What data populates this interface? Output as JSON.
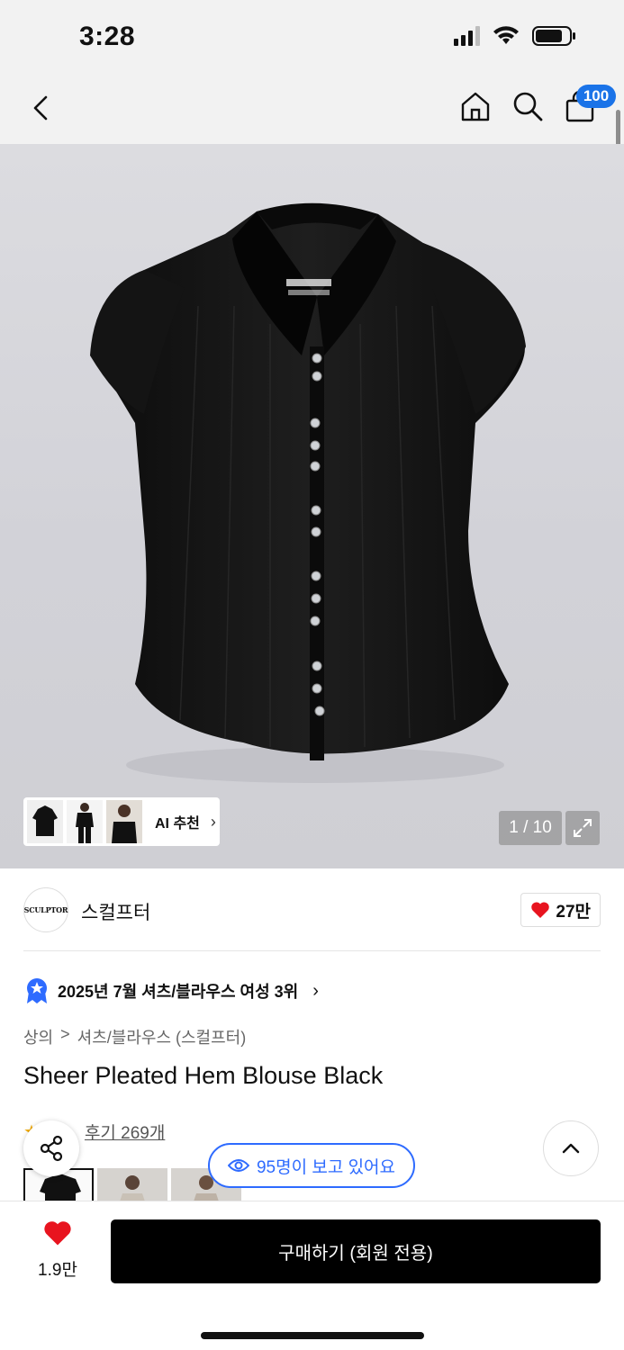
{
  "status_bar": {
    "time": "3:28",
    "battery_percent": 75
  },
  "header": {
    "back_icon": "chevron-left-icon",
    "home_icon": "home-icon",
    "search_icon": "search-icon",
    "cart_icon": "bag-icon",
    "cart_badge": "100",
    "badge_color": "#1a73e8"
  },
  "gallery": {
    "ai_recommend_label": "AI 추천",
    "counter": "1 / 10",
    "expand_icon": "expand-icon"
  },
  "brand": {
    "logo_text": "SCULPTOR",
    "name": "스컬프터",
    "like_count": "27만"
  },
  "ranking": {
    "badge_icon": "rank-star-badge-icon",
    "text": "2025년 7월 셔츠/블라우스 여성 3위"
  },
  "breadcrumb": {
    "level1": "상의",
    "separator": ">",
    "level2": "셔츠/블라우스 (스컬프터)"
  },
  "product": {
    "title": "Sheer Pleated Hem Blouse Black",
    "review_text": "후기 269개"
  },
  "viewers": {
    "text": "95명이 보고 있어요",
    "accent": "#2e6bff"
  },
  "bottom_bar": {
    "favorite_count": "1.9만",
    "buy_label": "구매하기 (회원 전용)",
    "heart_color": "#e8141f"
  }
}
